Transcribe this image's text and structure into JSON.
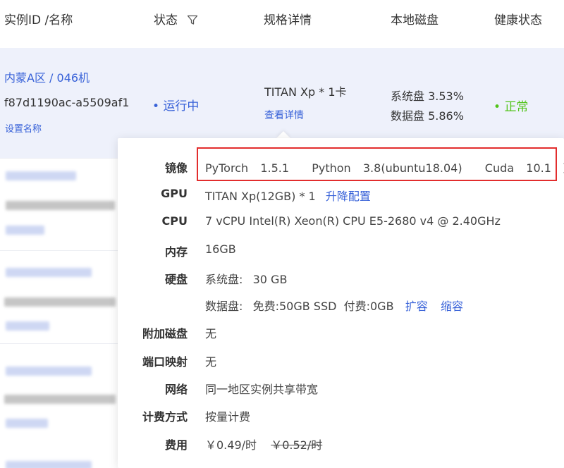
{
  "table": {
    "headers": {
      "instance": "实例ID /名称",
      "status": "状态",
      "spec": "规格详情",
      "disk": "本地磁盘",
      "health": "健康状态"
    }
  },
  "active_row": {
    "region_link": "内蒙A区 / 046机",
    "instance_id": "f87d1190ac-a5509af1",
    "set_name": "设置名称",
    "status_dot": "•",
    "status": "运行中",
    "gpu_spec": "TITAN Xp * 1卡",
    "view_details": "查看详情",
    "system_disk": "系统盘 3.53%",
    "data_disk": "数据盘 5.86%",
    "health_dot": "•",
    "health": "正常"
  },
  "colors": {
    "link": "#3761d8",
    "status_running": "#3761d8",
    "health_ok": "#52c41a",
    "highlight_box": "#e22d2d",
    "row_bg": "#eef1fb"
  },
  "details": {
    "image": {
      "label": "镜像",
      "pytorch_name": "PyTorch",
      "pytorch_ver": "1.5.1",
      "python_name": "Python",
      "python_ver": "3.8(ubuntu18.04)",
      "cuda_name": "Cuda",
      "cuda_ver": "10.1",
      "change": "更换"
    },
    "gpu": {
      "label": "GPU",
      "value": "TITAN Xp(12GB) * 1",
      "action": "升降配置"
    },
    "cpu": {
      "label": "CPU",
      "value": "7 vCPU Intel(R) Xeon(R) CPU E5-2680 v4 @ 2.40GHz"
    },
    "memory": {
      "label": "内存",
      "value": "16GB"
    },
    "disk": {
      "label": "硬盘",
      "system_label": "系统盘:",
      "system_value": "30 GB",
      "data_label": "数据盘:",
      "data_value": "免费:50GB SSD  付费:0GB",
      "expand": "扩容",
      "shrink": "缩容"
    },
    "extra_disk": {
      "label": "附加磁盘",
      "value": "无"
    },
    "port_mapping": {
      "label": "端口映射",
      "value": "无"
    },
    "network": {
      "label": "网络",
      "value": "同一地区实例共享带宽"
    },
    "billing": {
      "label": "计费方式",
      "value": "按量计费"
    },
    "fee": {
      "label": "费用",
      "current": "￥0.49/时",
      "original": "￥0.52/时"
    }
  }
}
